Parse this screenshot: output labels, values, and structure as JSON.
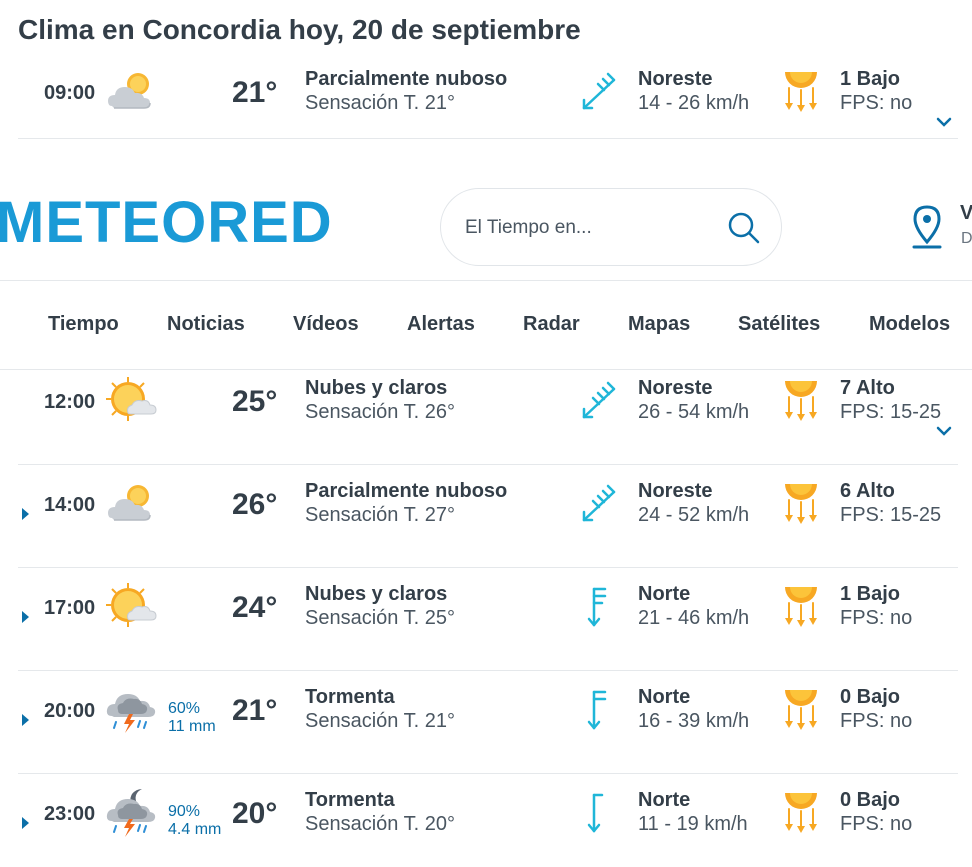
{
  "page": {
    "title": "Clima en Concordia hoy, 20 de septiembre"
  },
  "header": {
    "logo_text": "METEORED",
    "search_placeholder": "El Tiempo en...",
    "location_initial": "V",
    "location_sub": "D",
    "nav": [
      "Tiempo",
      "Noticias",
      "Vídeos",
      "Alertas",
      "Radar",
      "Mapas",
      "Satélites",
      "Modelos"
    ]
  },
  "colors": {
    "accent": "#0b6fa8",
    "wind": "#1fb6d8",
    "sun": "#f7a823",
    "logo": "#1a9ad6"
  },
  "rows": [
    {
      "hour": "09:00",
      "icon": "partly-cloudy-icon",
      "temp": "21°",
      "desc": "Parcialmente nuboso",
      "feel": "Sensación T. 21°",
      "wind_dir": "Noreste",
      "wind_speed": "14 - 26 km/h",
      "uv": "1 Bajo",
      "fps": "FPS: no"
    },
    {
      "hour": "12:00",
      "icon": "sun-clouds-icon",
      "temp": "25°",
      "desc": "Nubes y claros",
      "feel": "Sensación T. 26°",
      "wind_dir": "Noreste",
      "wind_speed": "26 - 54 km/h",
      "uv": "7 Alto",
      "fps": "FPS: 15-25"
    },
    {
      "hour": "14:00",
      "icon": "partly-cloudy-icon",
      "temp": "26°",
      "desc": "Parcialmente nuboso",
      "feel": "Sensación T. 27°",
      "wind_dir": "Noreste",
      "wind_speed": "24 - 52 km/h",
      "uv": "6 Alto",
      "fps": "FPS: 15-25"
    },
    {
      "hour": "17:00",
      "icon": "sun-clouds-icon",
      "temp": "24°",
      "desc": "Nubes y claros",
      "feel": "Sensación T. 25°",
      "wind_dir": "Norte",
      "wind_speed": "21 - 46 km/h",
      "uv": "1 Bajo",
      "fps": "FPS: no"
    },
    {
      "hour": "20:00",
      "icon": "thunderstorm-icon",
      "precip_prob": "60%",
      "precip_amount": "11 mm",
      "temp": "21°",
      "desc": "Tormenta",
      "feel": "Sensación T. 21°",
      "wind_dir": "Norte",
      "wind_speed": "16 - 39 km/h",
      "uv": "0 Bajo",
      "fps": "FPS: no"
    },
    {
      "hour": "23:00",
      "icon": "night-thunderstorm-icon",
      "precip_prob": "90%",
      "precip_amount": "4.4 mm",
      "temp": "20°",
      "desc": "Tormenta",
      "feel": "Sensación T. 20°",
      "wind_dir": "Norte",
      "wind_speed": "11 - 19 km/h",
      "uv": "0 Bajo",
      "fps": "FPS: no"
    }
  ]
}
